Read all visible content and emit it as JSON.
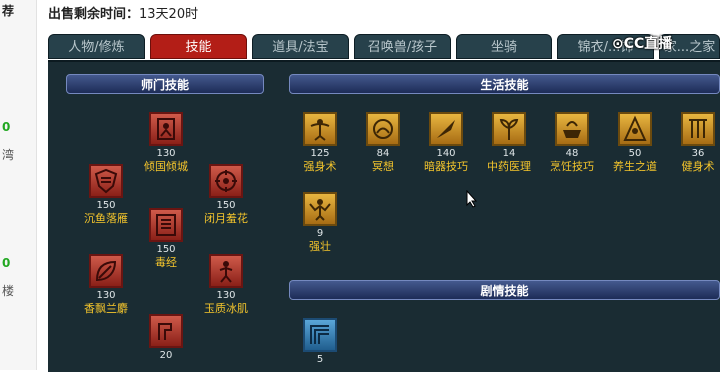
{
  "left_strip": {
    "t1": "荐",
    "t2": "0",
    "t3": "湾",
    "t4": "0",
    "t5": "楼"
  },
  "header": {
    "label": "出售剩余时间：",
    "value": "13天20时"
  },
  "watermark": "CC直播",
  "tabs": [
    {
      "label": "人物/修炼"
    },
    {
      "label": "技能",
      "active": true
    },
    {
      "label": "道具/法宝"
    },
    {
      "label": "召唤兽/孩子"
    },
    {
      "label": "坐骑"
    },
    {
      "label": "锦衣/...饰"
    },
    {
      "label": "家...之家"
    }
  ],
  "sections": {
    "shimen": "师门技能",
    "life": "生活技能",
    "story": "剧情技能"
  },
  "shimen_skills": [
    {
      "level": "130",
      "name": "倾国倾城",
      "icon": "portrait-icon"
    },
    {
      "level": "150",
      "name": "沉鱼落雁",
      "icon": "shield-icon"
    },
    {
      "level": "150",
      "name": "闭月羞花",
      "icon": "flower-icon"
    },
    {
      "level": "150",
      "name": "毒经",
      "icon": "book-icon"
    },
    {
      "level": "130",
      "name": "香飘兰麝",
      "icon": "leaf-icon"
    },
    {
      "level": "130",
      "name": "玉质冰肌",
      "icon": "figure-icon"
    },
    {
      "level": "20",
      "name": "",
      "icon": "portrait-icon"
    }
  ],
  "life_skills": [
    {
      "level": "125",
      "name": "强身术",
      "icon": "body-icon"
    },
    {
      "level": "84",
      "name": "冥想",
      "icon": "meditate-icon"
    },
    {
      "level": "140",
      "name": "暗器技巧",
      "icon": "dart-icon"
    },
    {
      "level": "14",
      "name": "中药医理",
      "icon": "herb-icon"
    },
    {
      "level": "48",
      "name": "烹饪技巧",
      "icon": "pot-icon"
    },
    {
      "level": "50",
      "name": "养生之道",
      "icon": "health-icon"
    },
    {
      "level": "36",
      "name": "健身术",
      "icon": "fitness-icon"
    },
    {
      "level": "9",
      "name": "强壮",
      "icon": "strong-icon"
    }
  ],
  "story_skills": [
    {
      "level": "5",
      "name": "",
      "icon": "map-icon"
    }
  ],
  "colors": {
    "panel": "#1a2c33",
    "tab_active": "#b31e17",
    "skill_name": "#f4c52c",
    "section": "#2c3f73"
  }
}
